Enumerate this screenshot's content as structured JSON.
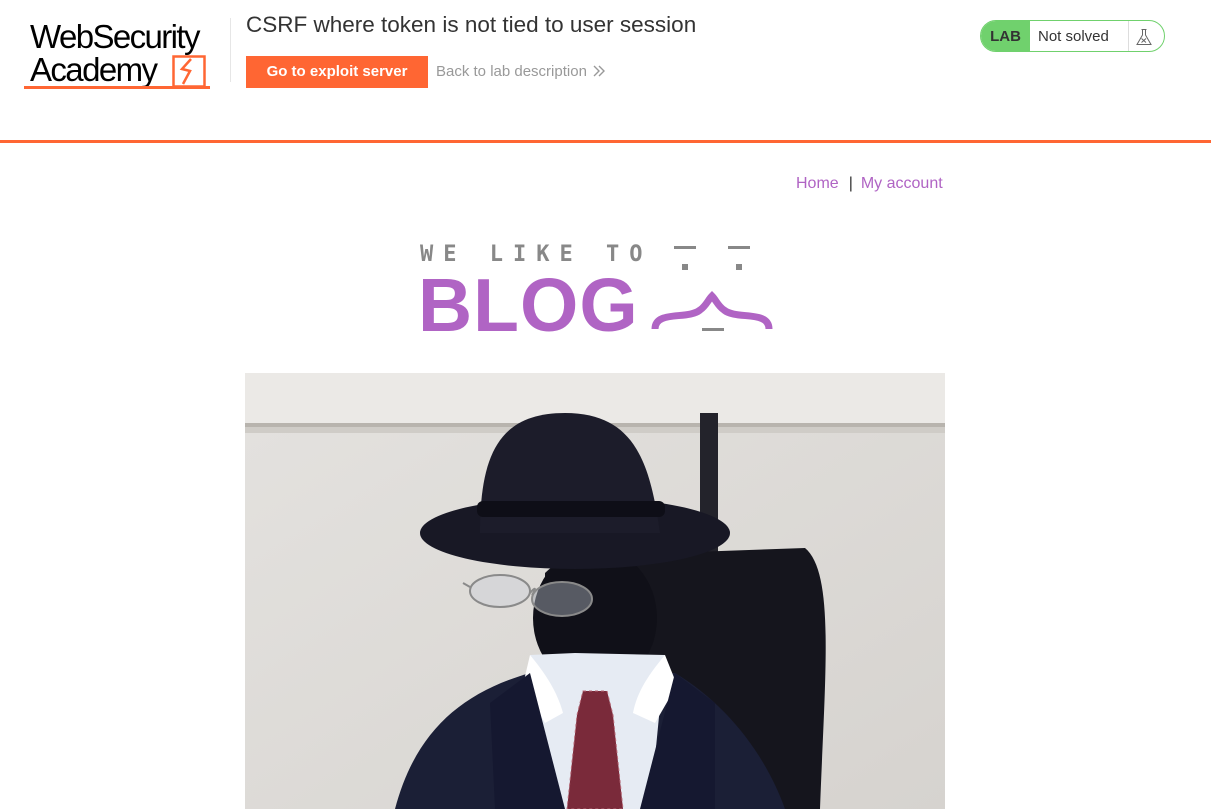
{
  "header": {
    "logo": {
      "line1": "WebSecurity",
      "line2": "Academy"
    },
    "lab_title": "CSRF where token is not tied to user session",
    "exploit_button": "Go to exploit server",
    "back_link": "Back to lab description",
    "status": {
      "badge": "LAB",
      "text": "Not solved",
      "icon": "flask-icon"
    }
  },
  "nav": {
    "home": "Home",
    "separator": "|",
    "my_account": "My account"
  },
  "banner": {
    "subtitle": "WE LIKE TO",
    "title": "BLOG"
  },
  "colors": {
    "accent": "#ff6633",
    "purple": "#b064c4",
    "status_green": "#70d16d"
  }
}
